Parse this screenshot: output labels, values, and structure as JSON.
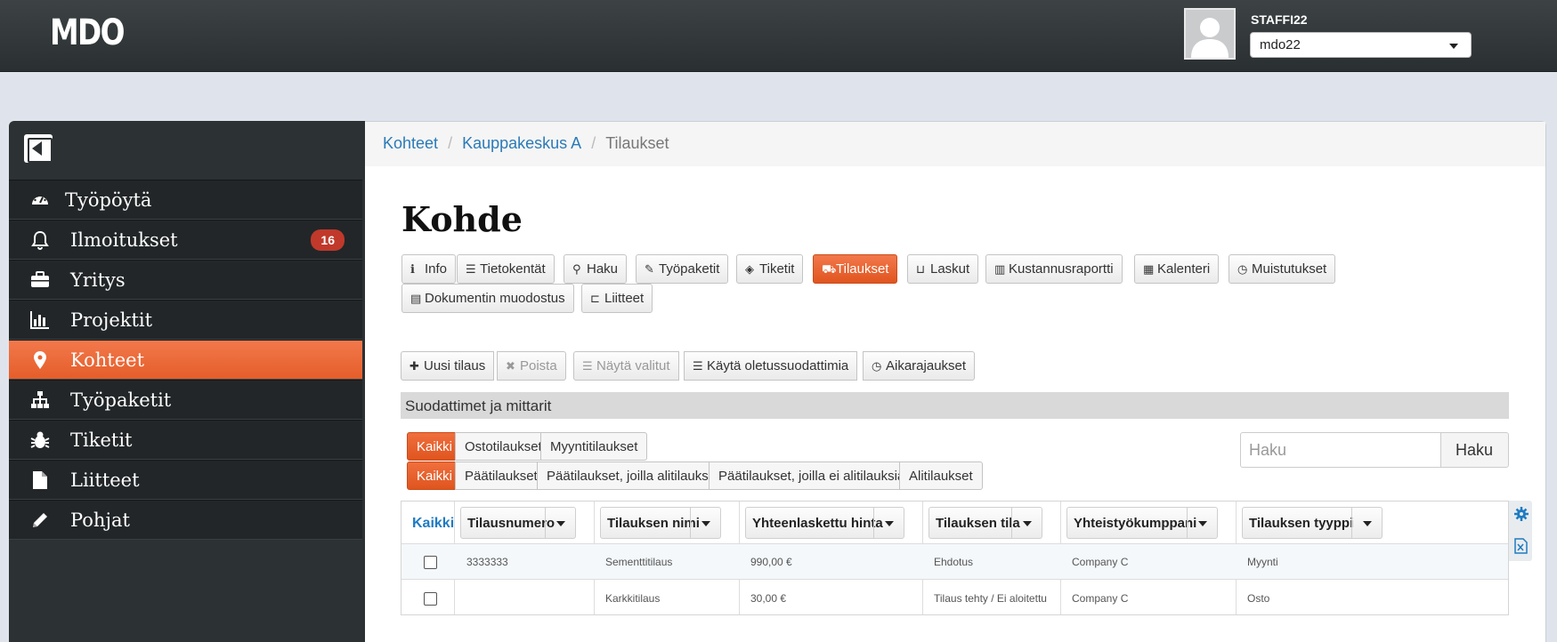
{
  "app": {
    "logo": "MDO"
  },
  "user": {
    "name": "STAFFI22",
    "selected": "mdo22"
  },
  "sidebar": {
    "items": [
      {
        "label": "Työpöytä",
        "icon": "dashboard-icon"
      },
      {
        "label": "Ilmoitukset",
        "icon": "bell-icon",
        "badge": "16"
      },
      {
        "label": "Yritys",
        "icon": "briefcase-icon"
      },
      {
        "label": "Projektit",
        "icon": "bar-chart-icon"
      },
      {
        "label": "Kohteet",
        "icon": "map-marker-icon",
        "active": true
      },
      {
        "label": "Työpaketit",
        "icon": "sitemap-icon"
      },
      {
        "label": "Tiketit",
        "icon": "bug-icon"
      },
      {
        "label": "Liitteet",
        "icon": "file-icon"
      },
      {
        "label": "Pohjat",
        "icon": "pencil-icon"
      }
    ]
  },
  "breadcrumb": {
    "items": [
      "Kohteet",
      "Kauppakeskus A",
      "Tilaukset"
    ]
  },
  "page": {
    "title": "Kohde"
  },
  "tabs": [
    {
      "label": "Info",
      "icon": "info-icon"
    },
    {
      "label": "Tietokentät",
      "icon": "list-icon"
    },
    {
      "label": "Haku",
      "icon": "search-icon"
    },
    {
      "label": "Työpaketit",
      "icon": "wrench-icon"
    },
    {
      "label": "Tiketit",
      "icon": "ticket-icon"
    },
    {
      "label": "Tilaukset",
      "icon": "cart-icon",
      "active": true
    },
    {
      "label": "Laskut",
      "icon": "inbox-icon"
    },
    {
      "label": "Kustannusraportti",
      "icon": "bar-chart-icon"
    },
    {
      "label": "Kalenteri",
      "icon": "calendar-icon"
    },
    {
      "label": "Muistutukset",
      "icon": "clock-icon"
    },
    {
      "label": "Dokumentin muodostus",
      "icon": "file-icon"
    },
    {
      "label": "Liitteet",
      "icon": "folder-open-icon"
    }
  ],
  "toolbar": {
    "new_order": "Uusi tilaus",
    "delete": "Poista",
    "show_selected": "Näytä valitut",
    "use_default_filters": "Käytä oletussuodattimia",
    "time_limits": "Aikarajaukset"
  },
  "filters": {
    "title": "Suodattimet ja mittarit",
    "group1": [
      "Kaikki",
      "Ostotilaukset",
      "Myyntitilaukset"
    ],
    "group2": [
      "Kaikki",
      "Päätilaukset",
      "Päätilaukset, joilla alitilauksia",
      "Päätilaukset, joilla ei alitilauksia",
      "Alitilaukset"
    ],
    "search_placeholder": "Haku",
    "search_button": "Haku"
  },
  "table": {
    "select_all": "Kaikki",
    "columns": [
      "Tilausnumero",
      "Tilauksen nimi",
      "Yhteenlaskettu hinta",
      "Tilauksen tila",
      "Yhteistyökumppani",
      "Tilauksen tyyppi"
    ],
    "rows": [
      [
        "3333333",
        "Sementtitilaus",
        "990,00 €",
        "Ehdotus",
        "Company C",
        "Myynti"
      ],
      [
        "",
        "Karkkitilaus",
        "30,00 €",
        "Tilaus tehty / Ei aloitettu",
        "Company C",
        "Osto"
      ]
    ]
  },
  "colors": {
    "accent": "#e8622f",
    "sidebar_bg": "#2c3133",
    "link": "#2a7ab8",
    "badge": "#c0392b"
  }
}
